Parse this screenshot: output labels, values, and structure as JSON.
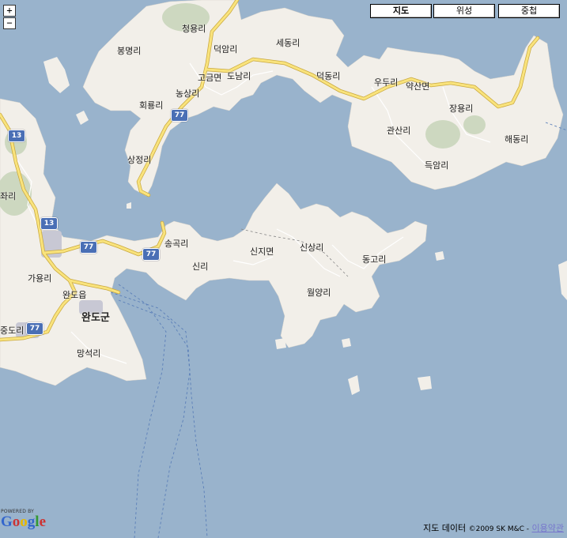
{
  "map": {
    "zoom_in": "+",
    "zoom_out": "−",
    "map_types": [
      {
        "label": "지도",
        "active": true
      },
      {
        "label": "위성",
        "active": false
      },
      {
        "label": "중첩",
        "active": false
      }
    ],
    "labels": {
      "cheongyongri": "청용리",
      "bongmyeongri": "봉명리",
      "deogamri": "덕암리",
      "sedongri": "세동리",
      "gogeummyeon": "고금면",
      "donamri": "도남리",
      "deokdongri": "덕동리",
      "wooduri": "우두리",
      "yaksanmyeon": "약산면",
      "nongsangri": "농상리",
      "hoeryongri": "회룡리",
      "jangyongri": "장용리",
      "gwansanri": "관산리",
      "haedongri": "해동리",
      "sangjeongri": "상정리",
      "deugamri": "득암리",
      "jari": "좌리",
      "songgokri": "송곡리",
      "sinjimyeon": "신지면",
      "sinsangri": "신상리",
      "donggori": "동고리",
      "sinri": "신리",
      "gayongri": "가용리",
      "wandoeup": "완도읍",
      "wolyangri": "월양리",
      "wandogun": "완도군",
      "jungdori": "중도리",
      "mangseokri": "망석리"
    },
    "route_shields": {
      "r13a": "13",
      "r13b": "13",
      "r77a": "77",
      "r77b": "77",
      "r77c": "77",
      "r77d": "77"
    },
    "logo": {
      "powered": "POWERED BY",
      "word": "Google"
    },
    "copyright": {
      "data_label": "지도 데이터",
      "notice": "©2009 SK M&C -",
      "terms_link": "이용약관"
    }
  },
  "colors": {
    "water": "#99b3cc",
    "land": "#f2efe9",
    "park": "#cdd8c0",
    "highway": "#f9e37c",
    "road": "#ffffff",
    "shield": "#4a6fb5",
    "urban": "#c8c8d4"
  }
}
